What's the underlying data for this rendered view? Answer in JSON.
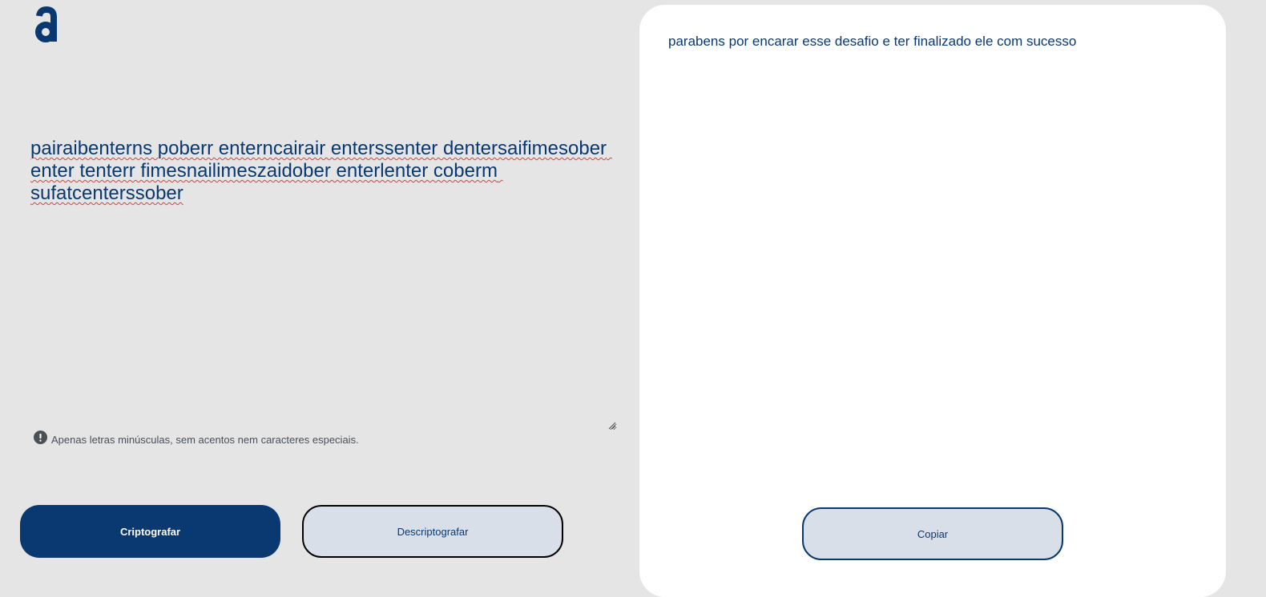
{
  "app": {
    "logo_icon": "alura-logo-icon",
    "colors": {
      "primary": "#0a3871",
      "background": "#e5e5e5",
      "button_light": "#d8dfe8",
      "panel": "#ffffff",
      "spellcheck": "#e53935"
    }
  },
  "input": {
    "value": "pairaibenterns poberr enterncairair enterssenter dentersaifimesober enter tenterr fimesnailimeszaidober enterlenter coberm sufatcenterssober"
  },
  "notice": {
    "icon": "exclamation-circle-icon",
    "text": "Apenas letras minúsculas, sem acentos nem caracteres especiais."
  },
  "buttons": {
    "encrypt_label": "Criptografar",
    "decrypt_label": "Descriptografar"
  },
  "output": {
    "text": "parabens por encarar esse desafio e ter finalizado ele com sucesso",
    "copy_label": "Copiar"
  }
}
